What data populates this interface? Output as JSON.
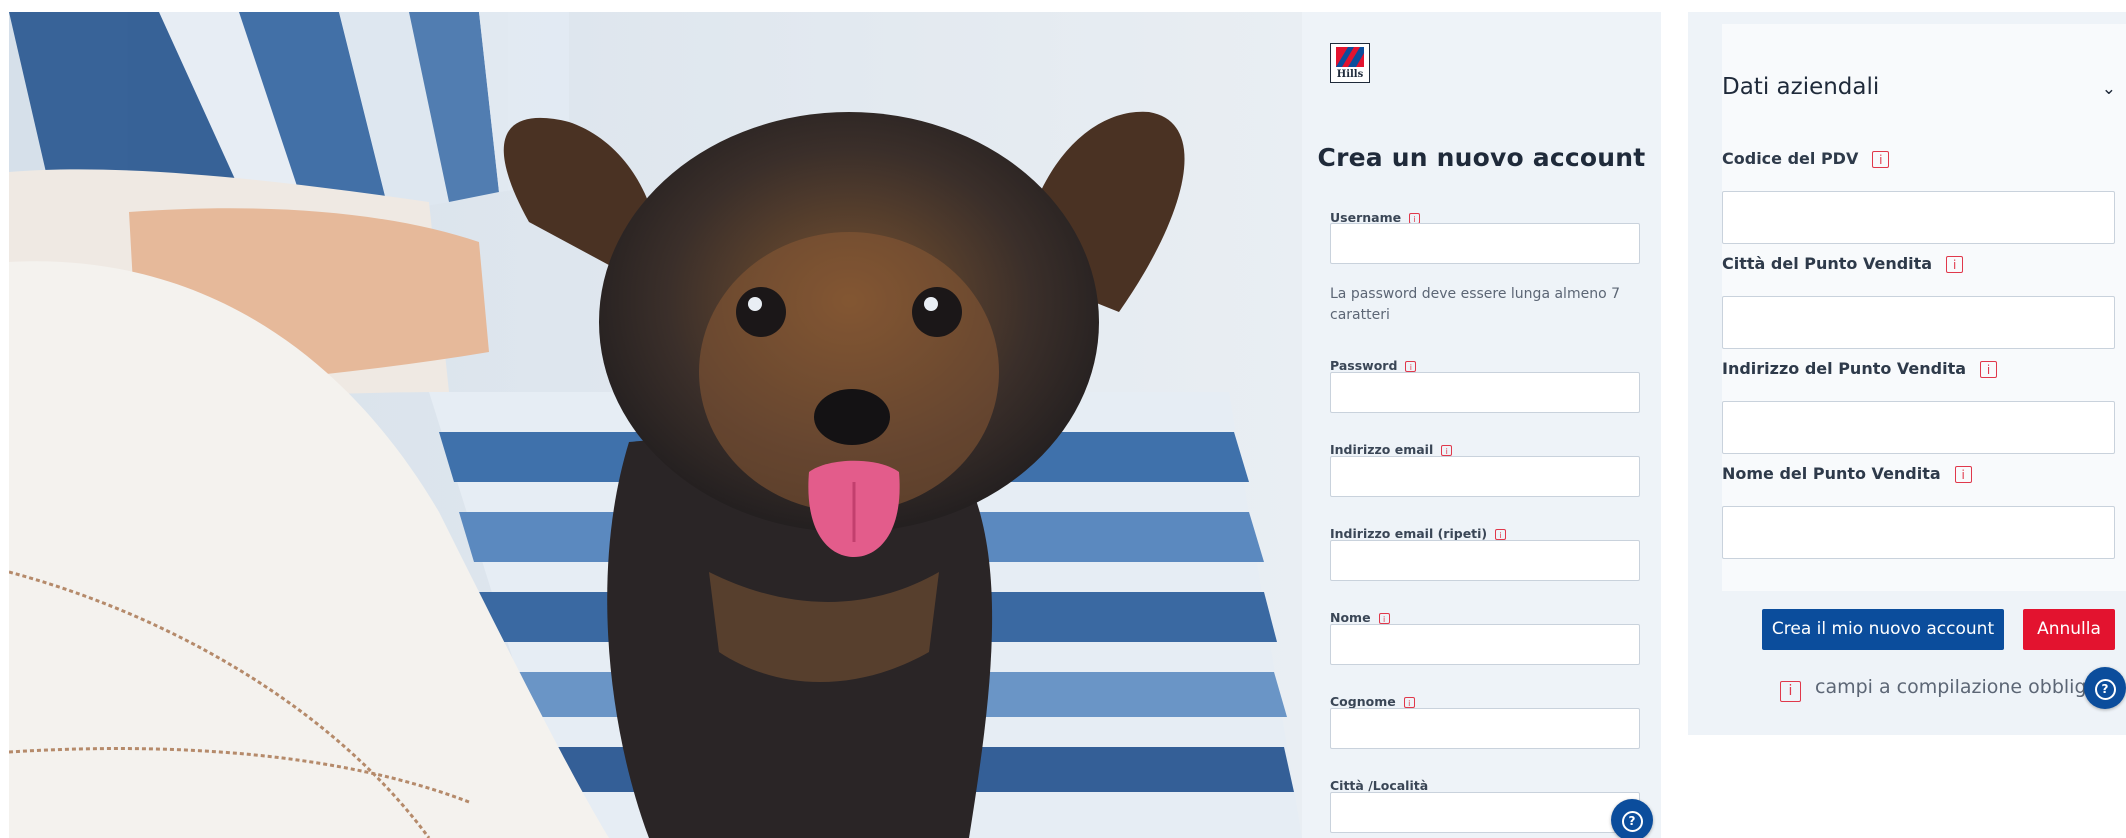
{
  "brand": {
    "logo_text": "Hills",
    "colors": {
      "primary": "#0b4d9c",
      "danger": "#e3132f",
      "info": "#e0384b",
      "panel_bg": "#eef3f8"
    }
  },
  "form": {
    "title": "Crea un nuovo account",
    "info_glyph": "i",
    "fields": {
      "username": "Username",
      "password_hint": "La password deve essere lunga almeno 7 caratteri",
      "password": "Password",
      "email": "Indirizzo email",
      "email_repeat": "Indirizzo email (ripeti)",
      "first_name": "Nome",
      "last_name": "Cognome",
      "city": "Città /Località"
    }
  },
  "company": {
    "title": "Dati aziendali",
    "chevron_icon": "chevron-down-icon",
    "fields": {
      "pdv_code": "Codice del PDV",
      "store_city": "Città del Punto Vendita",
      "store_address": "Indirizzo del Punto Vendita",
      "store_name": "Nome del Punto Vendita"
    }
  },
  "actions": {
    "create_label": "Crea il mio nuovo account",
    "cancel_label": "Annulla",
    "required_note": "campi a compilazione obbligat"
  },
  "help": {
    "icon": "help-icon",
    "glyph": "?"
  }
}
